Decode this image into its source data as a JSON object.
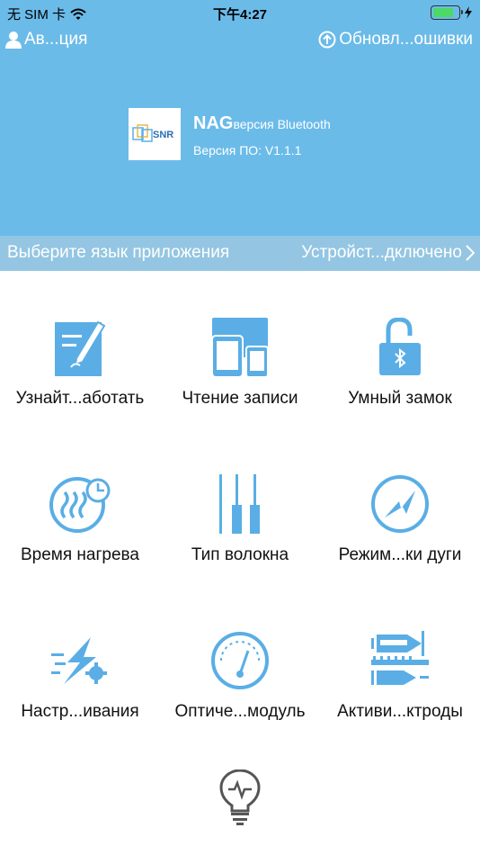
{
  "status_bar": {
    "carrier": "无 SIM 卡",
    "time": "下午4:27",
    "battery_level": 0.85
  },
  "top_nav": {
    "auth_label": "Ав...ция",
    "update_label": "Обновл...ошивки"
  },
  "device": {
    "logo_text": "SNR",
    "title_bold": "NAG",
    "title_rest": "версия Bluetooth",
    "firmware": "Версия ПО: V1.1.1"
  },
  "language_bar": {
    "language_label": "Выберите язык приложения",
    "device_status": "Устройст...дключено"
  },
  "menu": [
    {
      "label": "Узнайт...аботать",
      "icon": "edit-note-icon"
    },
    {
      "label": "Чтение записи",
      "icon": "devices-icon"
    },
    {
      "label": "Умный замок",
      "icon": "bluetooth-lock-icon"
    },
    {
      "label": "Время нагрева",
      "icon": "heat-timer-icon"
    },
    {
      "label": "Тип волокна",
      "icon": "fiber-type-icon"
    },
    {
      "label": "Режим...ки дуги",
      "icon": "arc-mode-icon"
    },
    {
      "label": "Настр...ивания",
      "icon": "settings-lightning-icon"
    },
    {
      "label": "Оптиче...модуль",
      "icon": "gauge-icon"
    },
    {
      "label": "Активи...ктроды",
      "icon": "electrodes-icon"
    },
    {
      "label": "",
      "icon": "lightbulb-icon"
    }
  ],
  "colors": {
    "header": "#6bbbe9",
    "language_bar": "#94c6e3",
    "icon_blue": "#5aaee5",
    "icon_gray": "#555555"
  }
}
